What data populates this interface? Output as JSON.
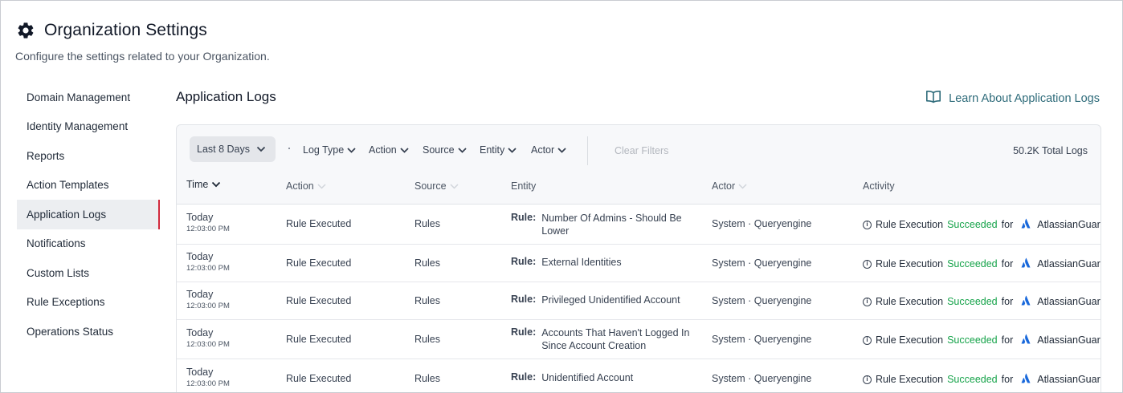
{
  "header": {
    "title": "Organization Settings",
    "subtitle": "Configure the settings related to your Organization."
  },
  "sidebar": {
    "items": [
      {
        "label": "Domain Management"
      },
      {
        "label": "Identity Management"
      },
      {
        "label": "Reports"
      },
      {
        "label": "Action Templates"
      },
      {
        "label": "Application Logs",
        "active": true
      },
      {
        "label": "Notifications"
      },
      {
        "label": "Custom Lists"
      },
      {
        "label": "Rule Exceptions"
      },
      {
        "label": "Operations Status"
      }
    ]
  },
  "main": {
    "title": "Application Logs",
    "learn_link": "Learn About Application Logs"
  },
  "filters": {
    "date_range": "Last 8 Days",
    "log_type": "Log Type",
    "action": "Action",
    "source": "Source",
    "entity": "Entity",
    "actor": "Actor",
    "clear": "Clear Filters",
    "total": "50.2K Total Logs"
  },
  "table": {
    "columns": {
      "time": "Time",
      "action": "Action",
      "source": "Source",
      "entity": "Entity",
      "actor": "Actor",
      "activity": "Activity"
    },
    "rows": [
      {
        "date": "Today",
        "time": "12:03:00 PM",
        "action": "Rule Executed",
        "source": "Rules",
        "entity_prefix": "Rule:",
        "entity": "Number Of Admins - Should Be Lower",
        "actor": "System · Queryengine",
        "activity_pre": "Rule Execution",
        "activity_status": "Succeeded",
        "activity_post": "for",
        "activity_target": "AtlassianGuard"
      },
      {
        "date": "Today",
        "time": "12:03:00 PM",
        "action": "Rule Executed",
        "source": "Rules",
        "entity_prefix": "Rule:",
        "entity": "External Identities",
        "actor": "System · Queryengine",
        "activity_pre": "Rule Execution",
        "activity_status": "Succeeded",
        "activity_post": "for",
        "activity_target": "AtlassianGuard"
      },
      {
        "date": "Today",
        "time": "12:03:00 PM",
        "action": "Rule Executed",
        "source": "Rules",
        "entity_prefix": "Rule:",
        "entity": "Privileged Unidentified Account",
        "actor": "System · Queryengine",
        "activity_pre": "Rule Execution",
        "activity_status": "Succeeded",
        "activity_post": "for",
        "activity_target": "AtlassianGuard"
      },
      {
        "date": "Today",
        "time": "12:03:00 PM",
        "action": "Rule Executed",
        "source": "Rules",
        "entity_prefix": "Rule:",
        "entity": "Accounts That Haven't Logged In Since Account Creation",
        "actor": "System · Queryengine",
        "activity_pre": "Rule Execution",
        "activity_status": "Succeeded",
        "activity_post": "for",
        "activity_target": "AtlassianGuard"
      },
      {
        "date": "Today",
        "time": "12:03:00 PM",
        "action": "Rule Executed",
        "source": "Rules",
        "entity_prefix": "Rule:",
        "entity": "Unidentified Account",
        "actor": "System · Queryengine",
        "activity_pre": "Rule Execution",
        "activity_status": "Succeeded",
        "activity_post": "for",
        "activity_target": "AtlassianGuard"
      }
    ]
  },
  "colors": {
    "accent": "#d12a3d",
    "link": "#2e6b7a",
    "success": "#16a34a",
    "atlassian": "#1868db"
  },
  "icons": {
    "header": "gear-icon",
    "learn": "book-icon",
    "activity_info": "info-icon",
    "activity_target": "atlassian-logo-icon",
    "sort": "chevron-down-icon"
  }
}
